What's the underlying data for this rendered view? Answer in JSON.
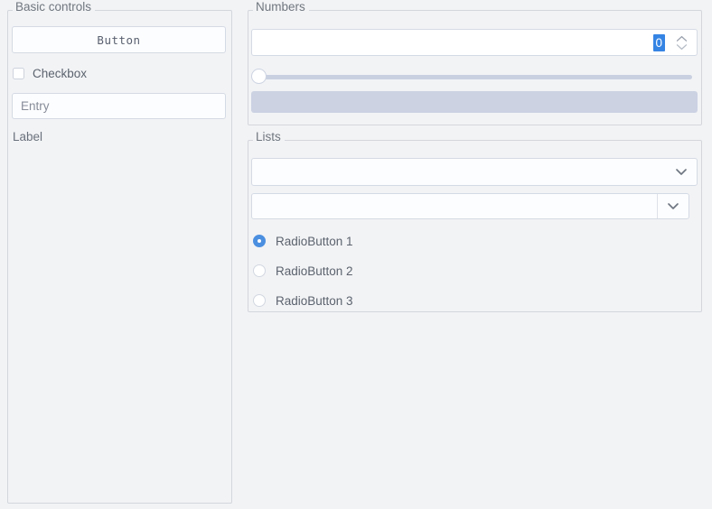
{
  "groups": {
    "basic": {
      "title": "Basic controls",
      "button_label": "Button",
      "checkbox_label": "Checkbox",
      "checkbox_checked": false,
      "entry_value": "",
      "entry_placeholder": "Entry",
      "label_text": "Label"
    },
    "numbers": {
      "title": "Numbers",
      "spinbox_value": "0",
      "spinbox_selected": true,
      "spinbox_up_icon": "chevron-up-icon",
      "spinbox_down_icon": "chevron-down-icon",
      "slider_value": 0,
      "slider_min": 0,
      "slider_max": 100,
      "progress_value": 0,
      "progress_max": 100
    },
    "lists": {
      "title": "Lists",
      "combo_1_value": "",
      "combo_1_icon": "chevron-down-icon",
      "combo_2_value": "",
      "combo_2_icon": "chevron-down-icon",
      "radios": [
        {
          "label": "RadioButton 1",
          "selected": true
        },
        {
          "label": "RadioButton 2",
          "selected": false
        },
        {
          "label": "RadioButton 3",
          "selected": false
        }
      ]
    }
  },
  "colors": {
    "window_background": "#f2f3f5",
    "frame_border": "#d3d6dc",
    "field_background": "#fcfdfe",
    "field_border": "#d4dae4",
    "text": "#5c636e",
    "label_text": "#70777f",
    "selection_blue": "#3584e4",
    "radio_blue": "#4b8fe0",
    "track_blue_grey": "#c9d0e0",
    "progress_trough": "#ccd2e2"
  }
}
